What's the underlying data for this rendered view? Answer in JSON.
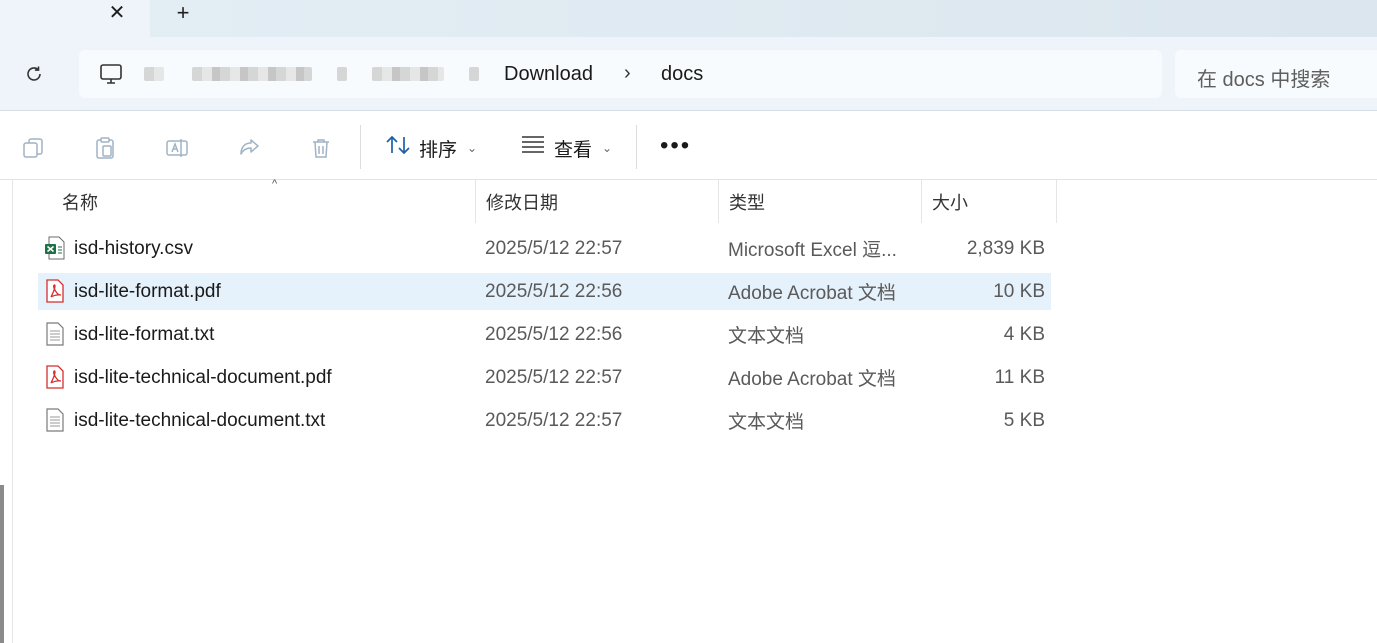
{
  "tabs": {
    "close_symbol": "✕",
    "add_symbol": "+"
  },
  "address": {
    "crumbs": [
      "Download",
      "docs"
    ],
    "separator": "›"
  },
  "search": {
    "placeholder": "在 docs 中搜索"
  },
  "toolbar": {
    "sort_label": "排序",
    "view_label": "查看",
    "more_label": "•••"
  },
  "columns": {
    "name": "名称",
    "date": "修改日期",
    "type": "类型",
    "size": "大小"
  },
  "files": [
    {
      "name": "isd-history.csv",
      "date": "2025/5/12 22:57",
      "type": "Microsoft Excel 逗...",
      "size": "2,839 KB",
      "icon": "excel-csv-icon",
      "selected": false
    },
    {
      "name": "isd-lite-format.pdf",
      "date": "2025/5/12 22:56",
      "type": "Adobe Acrobat 文档",
      "size": "10 KB",
      "icon": "pdf-icon",
      "selected": true
    },
    {
      "name": "isd-lite-format.txt",
      "date": "2025/5/12 22:56",
      "type": "文本文档",
      "size": "4 KB",
      "icon": "text-file-icon",
      "selected": false
    },
    {
      "name": "isd-lite-technical-document.pdf",
      "date": "2025/5/12 22:57",
      "type": "Adobe Acrobat 文档",
      "size": "11 KB",
      "icon": "pdf-icon",
      "selected": false
    },
    {
      "name": "isd-lite-technical-document.txt",
      "date": "2025/5/12 22:57",
      "type": "文本文档",
      "size": "5 KB",
      "icon": "text-file-icon",
      "selected": false
    }
  ],
  "colors": {
    "accent": "#0067c0",
    "selection": "#e5f1fb",
    "chrome": "#eef4f9",
    "pdf_red": "#d32f2f",
    "excel_green": "#1e7145"
  }
}
